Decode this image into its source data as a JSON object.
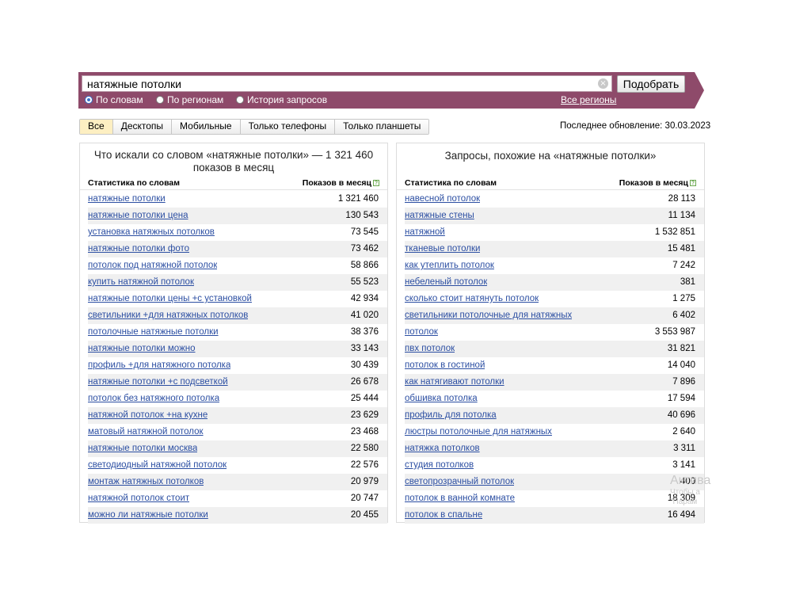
{
  "search": {
    "query": "натяжные потолки",
    "submit_label": "Подобрать",
    "modes": [
      {
        "label": "По словам",
        "checked": true
      },
      {
        "label": "По регионам",
        "checked": false
      },
      {
        "label": "История запросов",
        "checked": false
      }
    ],
    "regions_link": "Все регионы"
  },
  "tabs": [
    "Все",
    "Десктопы",
    "Мобильные",
    "Только телефоны",
    "Только планшеты"
  ],
  "last_update": "Последнее обновление: 30.03.2023",
  "left": {
    "title": "Что искали со словом «натяжные потолки» — 1 321 460 показов в месяц",
    "col_words": "Статистика по словам",
    "col_count": "Показов в месяц",
    "rows": [
      {
        "q": "натяжные потолки",
        "n": "1 321 460"
      },
      {
        "q": "натяжные потолки цена",
        "n": "130 543"
      },
      {
        "q": "установка натяжных потолков",
        "n": "73 545"
      },
      {
        "q": "натяжные потолки фото",
        "n": "73 462"
      },
      {
        "q": "потолок под натяжной потолок",
        "n": "58 866"
      },
      {
        "q": "купить натяжной потолок",
        "n": "55 523"
      },
      {
        "q": "натяжные потолки цены +с установкой",
        "n": "42 934"
      },
      {
        "q": "светильники +для натяжных потолков",
        "n": "41 020"
      },
      {
        "q": "потолочные натяжные потолки",
        "n": "38 376"
      },
      {
        "q": "натяжные потолки можно",
        "n": "33 143"
      },
      {
        "q": "профиль +для натяжного потолка",
        "n": "30 439"
      },
      {
        "q": "натяжные потолки +с подсветкой",
        "n": "26 678"
      },
      {
        "q": "потолок без натяжного потолка",
        "n": "25 444"
      },
      {
        "q": "натяжной потолок +на кухне",
        "n": "23 629"
      },
      {
        "q": "матовый натяжной потолок",
        "n": "23 468"
      },
      {
        "q": "натяжные потолки москва",
        "n": "22 580"
      },
      {
        "q": "светодиодный натяжной потолок",
        "n": "22 576"
      },
      {
        "q": "монтаж натяжных потолков",
        "n": "20 979"
      },
      {
        "q": "натяжной потолок стоит",
        "n": "20 747"
      },
      {
        "q": "можно ли натяжные потолки",
        "n": "20 455"
      }
    ]
  },
  "right": {
    "title": "Запросы, похожие на «натяжные потолки»",
    "col_words": "Статистика по словам",
    "col_count": "Показов в месяц",
    "rows": [
      {
        "q": "навесной потолок",
        "n": "28 113"
      },
      {
        "q": "натяжные стены",
        "n": "11 134"
      },
      {
        "q": "натяжной",
        "n": "1 532 851"
      },
      {
        "q": "тканевые потолки",
        "n": "15 481"
      },
      {
        "q": "как утеплить потолок",
        "n": "7 242"
      },
      {
        "q": "небеленый потолок",
        "n": "381"
      },
      {
        "q": "сколько стоит натянуть потолок",
        "n": "1 275"
      },
      {
        "q": "светильники потолочные для натяжных",
        "n": "6 402"
      },
      {
        "q": "потолок",
        "n": "3 553 987"
      },
      {
        "q": "пвх потолок",
        "n": "31 821"
      },
      {
        "q": "потолок в гостиной",
        "n": "14 040"
      },
      {
        "q": "как натягивают потолки",
        "n": "7 896"
      },
      {
        "q": "обшивка потолка",
        "n": "17 594"
      },
      {
        "q": "профиль для потолка",
        "n": "40 696"
      },
      {
        "q": "люстры потолочные для натяжных",
        "n": "2 640"
      },
      {
        "q": "натяжка потолков",
        "n": "3 311"
      },
      {
        "q": "студия потолков",
        "n": "3 141"
      },
      {
        "q": "светопрозрачный потолок",
        "n": "400"
      },
      {
        "q": "потолок в ванной комнате",
        "n": "18 309"
      },
      {
        "q": "потолок в спальне",
        "n": "16 494"
      }
    ]
  },
  "watermark": {
    "line1": "Актива",
    "line2": "Чтобы а",
    "line3": "\"Парам"
  },
  "colors": {
    "bar": "#8e4a6a",
    "link": "#2b4ea2",
    "active_tab": "#fdefc2"
  }
}
